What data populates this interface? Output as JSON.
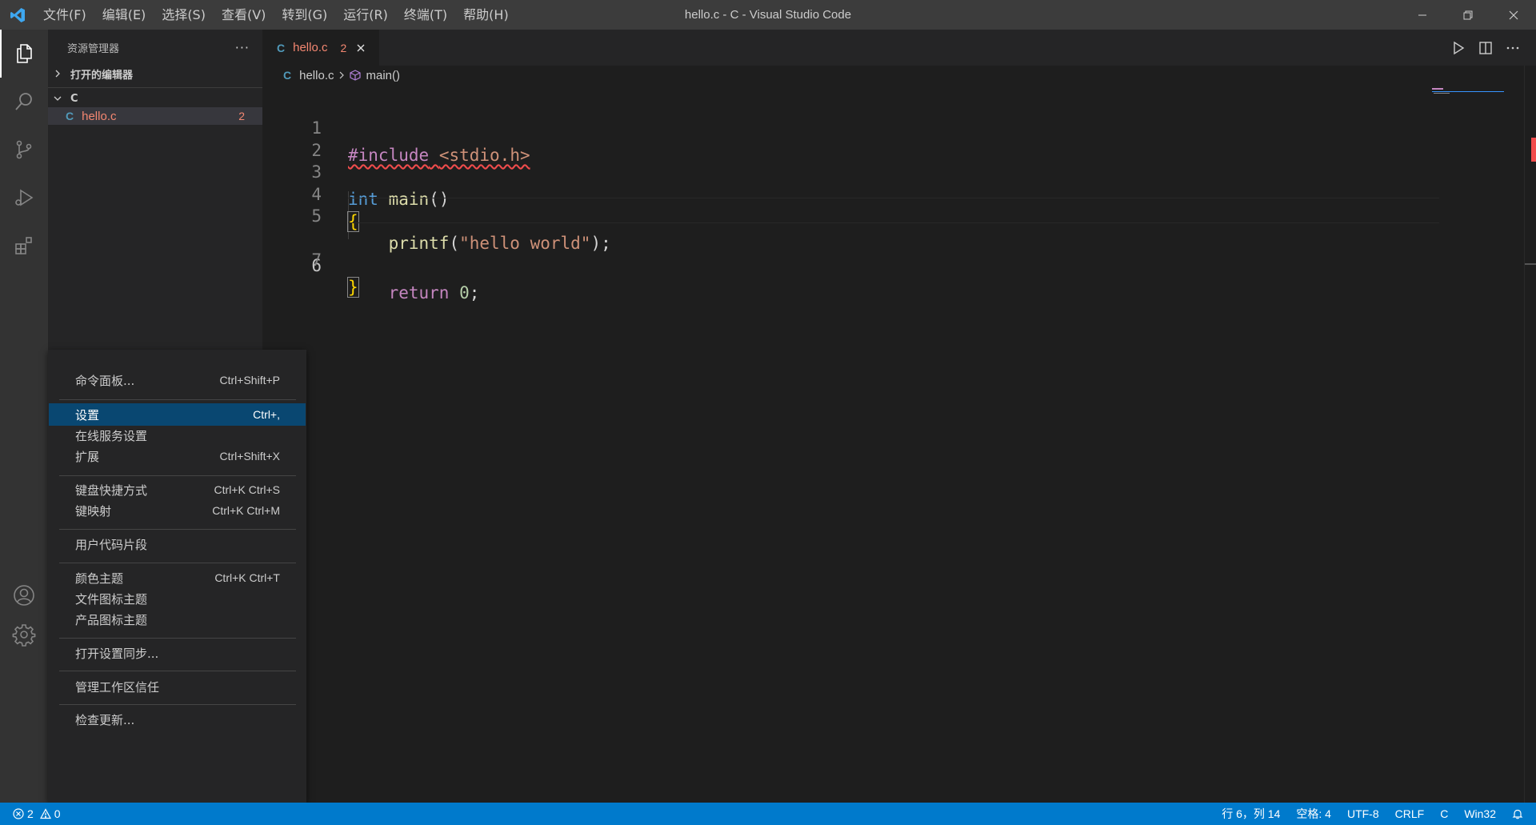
{
  "titlebar": {
    "menus": [
      "文件(F)",
      "编辑(E)",
      "选择(S)",
      "查看(V)",
      "转到(G)",
      "运行(R)",
      "终端(T)",
      "帮助(H)"
    ],
    "window_title": "hello.c - C - Visual Studio Code"
  },
  "sidebar": {
    "title": "资源管理器",
    "more_label": "···",
    "open_editors_label": "打开的编辑器",
    "folder_label": "C",
    "file": {
      "icon_letter": "C",
      "name": "hello.c",
      "problems": "2"
    }
  },
  "editor": {
    "tab": {
      "icon_letter": "C",
      "name": "hello.c",
      "problems": "2"
    },
    "breadcrumb": {
      "file_icon_letter": "C",
      "file": "hello.c",
      "symbol": "main()"
    },
    "line_numbers": [
      "1",
      "2",
      "3",
      "4",
      "5",
      "6",
      "7"
    ],
    "code": {
      "l1_directive": "#include",
      "l1_header": "<stdio.h>",
      "l3_type": "int",
      "l3_func": "main",
      "l3_parens": "()",
      "l4_brace": "{",
      "l5_func": "printf",
      "l5_open": "(",
      "l5_string": "\"hello world\"",
      "l5_close": ");",
      "l6_keyword": "return",
      "l6_number": "0",
      "l6_semi": ";",
      "l7_brace": "}"
    }
  },
  "context_menu": {
    "items": [
      {
        "label": "命令面板...",
        "shortcut": "Ctrl+Shift+P"
      },
      {
        "label": "设置",
        "shortcut": "Ctrl+,"
      },
      {
        "label": "在线服务设置",
        "shortcut": ""
      },
      {
        "label": "扩展",
        "shortcut": "Ctrl+Shift+X"
      },
      {
        "label": "键盘快捷方式",
        "shortcut": "Ctrl+K Ctrl+S"
      },
      {
        "label": "键映射",
        "shortcut": "Ctrl+K Ctrl+M"
      },
      {
        "label": "用户代码片段",
        "shortcut": ""
      },
      {
        "label": "颜色主题",
        "shortcut": "Ctrl+K Ctrl+T"
      },
      {
        "label": "文件图标主题",
        "shortcut": ""
      },
      {
        "label": "产品图标主题",
        "shortcut": ""
      },
      {
        "label": "打开设置同步...",
        "shortcut": ""
      },
      {
        "label": "管理工作区信任",
        "shortcut": ""
      },
      {
        "label": "检查更新...",
        "shortcut": ""
      }
    ]
  },
  "statusbar": {
    "errors": "2",
    "warnings": "0",
    "position": "行 6，列 14",
    "indent": "空格: 4",
    "encoding": "UTF-8",
    "eol": "CRLF",
    "language": "C",
    "platform": "Win32"
  },
  "colors": {
    "accent": "#007acc",
    "menu_selected": "#094771",
    "error": "#f48771"
  },
  "icons": {
    "activity": [
      "explorer-icon",
      "search-icon",
      "source-control-icon",
      "run-debug-icon",
      "extensions-icon",
      "accounts-icon",
      "manage-gear-icon"
    ],
    "editor_actions": [
      "run-icon",
      "split-editor-icon",
      "more-actions-icon"
    ]
  }
}
